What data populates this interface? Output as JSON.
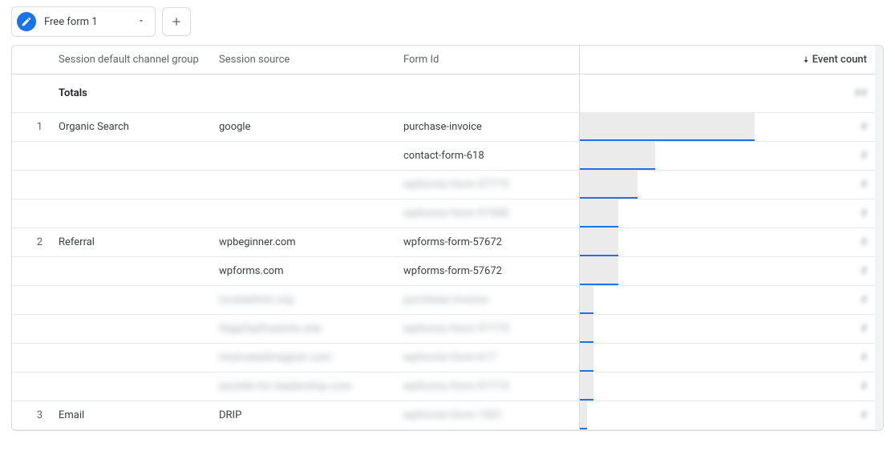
{
  "tab": {
    "label": "Free form 1"
  },
  "headers": {
    "channel": "Session default channel group",
    "source": "Session source",
    "form": "Form Id",
    "event": "Event count"
  },
  "totals": {
    "label": "Totals",
    "event_masked": "##"
  },
  "rows": [
    {
      "idx": "1",
      "channel": "Organic Search",
      "source": "google",
      "form": "purchase-invoice",
      "form_blur": false,
      "src_blur": false,
      "bar_pct": 100,
      "ev_masked": "#"
    },
    {
      "idx": "",
      "channel": "",
      "source": "",
      "form": "contact-form-618",
      "form_blur": false,
      "src_blur": false,
      "bar_pct": 43,
      "ev_masked": "#"
    },
    {
      "idx": "",
      "channel": "",
      "source": "",
      "form": "wpforms-form-57773",
      "form_blur": true,
      "src_blur": false,
      "bar_pct": 33,
      "ev_masked": "#"
    },
    {
      "idx": "",
      "channel": "",
      "source": "",
      "form": "wpforms-form-51506",
      "form_blur": true,
      "src_blur": false,
      "bar_pct": 22,
      "ev_masked": "#"
    },
    {
      "idx": "2",
      "channel": "Referral",
      "source": "wpbeginner.com",
      "form": "wpforms-form-57672",
      "form_blur": false,
      "src_blur": false,
      "bar_pct": 22,
      "ev_masked": "#"
    },
    {
      "idx": "",
      "channel": "",
      "source": "wpforms.com",
      "form": "wpforms-form-57672",
      "form_blur": false,
      "src_blur": false,
      "bar_pct": 22,
      "ev_masked": "#"
    },
    {
      "idx": "",
      "channel": "",
      "source": "localadmin.org",
      "form": "purchase-invoice",
      "form_blur": true,
      "src_blur": true,
      "bar_pct": 8,
      "ev_masked": "#"
    },
    {
      "idx": "",
      "channel": "",
      "source": "flagshipfinalsite.site",
      "form": "wpforms-form-57773",
      "form_blur": true,
      "src_blur": true,
      "bar_pct": 8,
      "ev_masked": "#"
    },
    {
      "idx": "",
      "channel": "",
      "source": "motivatedmagnet.com",
      "form": "wpforms-form-617",
      "form_blur": true,
      "src_blur": true,
      "bar_pct": 8,
      "ev_masked": "#"
    },
    {
      "idx": "",
      "channel": "",
      "source": "excelle-for-leadership.com",
      "form": "wpforms-form-57773",
      "form_blur": true,
      "src_blur": true,
      "bar_pct": 8,
      "ev_masked": "#"
    },
    {
      "idx": "3",
      "channel": "Email",
      "source": "DRIP",
      "form": "wpforms-form-1531",
      "form_blur": true,
      "src_blur": false,
      "bar_pct": 4,
      "ev_masked": "#"
    }
  ]
}
